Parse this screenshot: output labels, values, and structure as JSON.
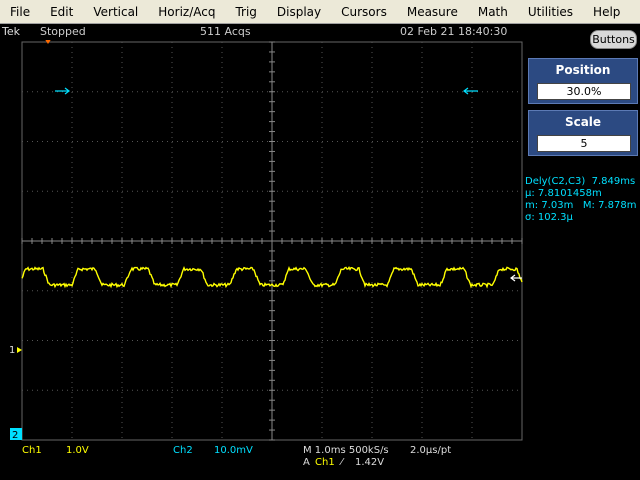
{
  "menu": [
    "File",
    "Edit",
    "Vertical",
    "Horiz/Acq",
    "Trig",
    "Display",
    "Cursors",
    "Measure",
    "Math",
    "Utilities",
    "Help"
  ],
  "status": {
    "logo": "Tek",
    "run_state": "Stopped",
    "acqs": "511 Acqs",
    "datetime": "02 Feb 21 18:40:30"
  },
  "side": {
    "buttons_label": "Buttons",
    "position": {
      "title": "Position",
      "value": "30.0%"
    },
    "scale": {
      "title": "Scale",
      "value": "5"
    }
  },
  "measurement": {
    "line1_label": "Dely(C2,C3)",
    "line1_value": "7.849ms",
    "line2_label": "µ:",
    "line2_value": "7.8101458m",
    "line3_m_label": "m:",
    "line3_m_value": "7.03m",
    "line3_M_label": "M:",
    "line3_M_value": "7.878m",
    "line4_label": "σ:",
    "line4_value": "102.3µ"
  },
  "markers": {
    "ch1": "1",
    "ch2": "2"
  },
  "bottom": {
    "ch1_label": "Ch1",
    "ch1_scale": "1.0V",
    "ch2_label": "Ch2",
    "ch2_scale": "10.0mV",
    "timebase": "M 1.0ms 500kS/s",
    "pt": "2.0µs/pt",
    "trig_prefix": "A",
    "trig_source": "Ch1",
    "trig_slope": "⁄",
    "trig_level": "1.42V"
  },
  "colors": {
    "ch1": "#ffff00",
    "ch2": "#00e0ff",
    "panel": "#2c4a82"
  },
  "waveform": {
    "high": 0.72,
    "low": 0.28,
    "cycles": 9.5
  }
}
